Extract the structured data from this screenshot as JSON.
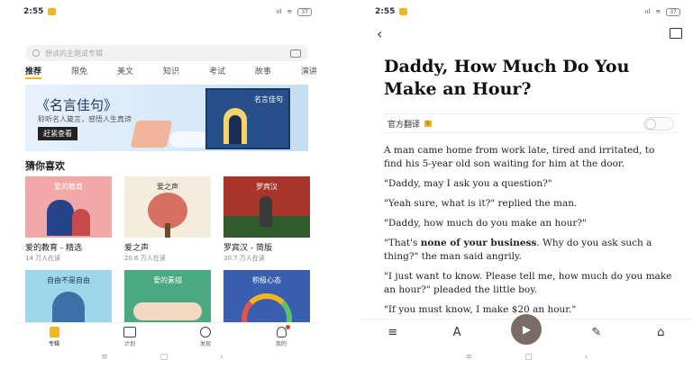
{
  "status_bar": {
    "time": "2:55",
    "signal": "ııl",
    "wifi": "≋",
    "battery": "37"
  },
  "home": {
    "search_placeholder": "想读的主题或专辑",
    "tabs": [
      "推荐",
      "限免",
      "美文",
      "知识",
      "考试",
      "故事",
      "演讲"
    ],
    "banner": {
      "title": "《名言佳句》",
      "subtitle": "聆听名人箴言，感悟人生真谛",
      "cta": "赶紧查看",
      "book_title": "名言佳句"
    },
    "section_title": "猜你喜欢",
    "books": [
      {
        "cover_text": "爱的教育",
        "name": "爱的教育 - 精选",
        "readers": "14 万人在读",
        "color": "#ef9a9a"
      },
      {
        "cover_text": "爱之声",
        "name": "爱之声",
        "readers": "20.6 万人在读",
        "color": "#f3ead8"
      },
      {
        "cover_text": "罗宾汉",
        "name": "罗宾汉 - 简版",
        "readers": "30.7 万人在读",
        "color": "#b63a2b"
      },
      {
        "cover_text": "自由不是自由",
        "name": "",
        "readers": "",
        "color": "#8ed0e8"
      },
      {
        "cover_text": "爱的素描",
        "name": "",
        "readers": "",
        "color": "#4aa882"
      },
      {
        "cover_text": "积极心态",
        "name": "",
        "readers": "",
        "color": "#3a5fb0"
      }
    ],
    "nav": [
      {
        "label": "专辑",
        "icon": "album-icon"
      },
      {
        "label": "计划",
        "icon": "calendar-icon"
      },
      {
        "label": "发现",
        "icon": "compass-icon"
      },
      {
        "label": "我的",
        "icon": "profile-icon"
      }
    ],
    "system_nav": [
      "≡",
      "▢",
      "‹"
    ]
  },
  "article": {
    "title": "Daddy, How Much Do You Make an Hour?",
    "translate_label": "官方翻译",
    "translate_badge": "5",
    "paragraphs": [
      "A man came home from work late, tired and irritated, to find his 5-year old son waiting for him at the door.",
      "\"Daddy, may I ask you a question?\"",
      "\"Yeah sure, what is it?\" replied the man.",
      "\"Daddy, how much do you make an hour?\"",
      "\"That's |none of your business|. Why do you ask such a thing?\" the man said angrily.",
      "\"I just want to know. Please tell me, how much do you make an hour?\" pleaded the little boy.",
      "\"If you must know, I make $20 an hour.\""
    ],
    "toolbar": {
      "menu": "≡",
      "font": "A",
      "play": "▶",
      "edit": "✎",
      "kit": "⌂"
    }
  }
}
